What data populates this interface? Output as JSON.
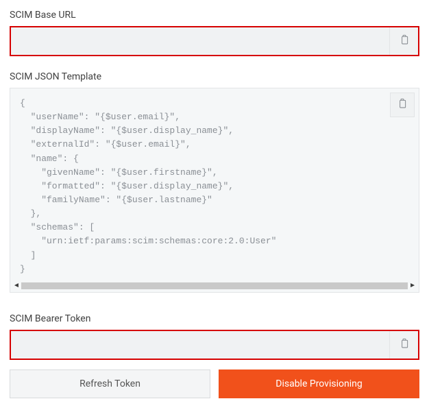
{
  "scim_base_url": {
    "label": "SCIM Base URL",
    "value": ""
  },
  "scim_json_template": {
    "label": "SCIM JSON Template",
    "code": "{\n  \"userName\": \"{$user.email}\",\n  \"displayName\": \"{$user.display_name}\",\n  \"externalId\": \"{$user.email}\",\n  \"name\": {\n    \"givenName\": \"{$user.firstname}\",\n    \"formatted\": \"{$user.display_name}\",\n    \"familyName\": \"{$user.lastname}\"\n  },\n  \"schemas\": [\n    \"urn:ietf:params:scim:schemas:core:2.0:User\"\n  ]\n}"
  },
  "scim_bearer_token": {
    "label": "SCIM Bearer Token",
    "value": ""
  },
  "buttons": {
    "refresh": "Refresh Token",
    "disable": "Disable Provisioning"
  },
  "icons": {
    "clipboard": "clipboard-icon"
  }
}
